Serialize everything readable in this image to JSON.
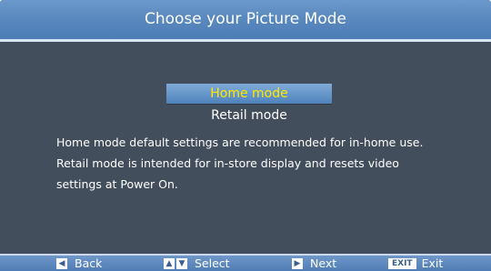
{
  "dialog": {
    "title": "Choose your Picture Mode",
    "options": [
      {
        "label": "Home mode",
        "selected": true
      },
      {
        "label": "Retail mode",
        "selected": false
      }
    ],
    "description": [
      "Home mode default settings are recommended for in-home use.",
      "Retail mode is intended for in-store display and resets video",
      "settings at Power On."
    ]
  },
  "footer": {
    "back_label": "Back",
    "select_label": "Select",
    "next_label": "Next",
    "exit_key": "EXIT",
    "exit_label": "Exit",
    "icons": {
      "back": "left-arrow-key-icon",
      "select": "up-down-arrow-keys-icon",
      "next": "right-arrow-key-icon",
      "exit": "exit-key-icon"
    }
  },
  "colors": {
    "panel": "#424e5b",
    "title_bar": "#5a89bf",
    "selected_text": "#ffea00",
    "text": "#ffffff"
  }
}
